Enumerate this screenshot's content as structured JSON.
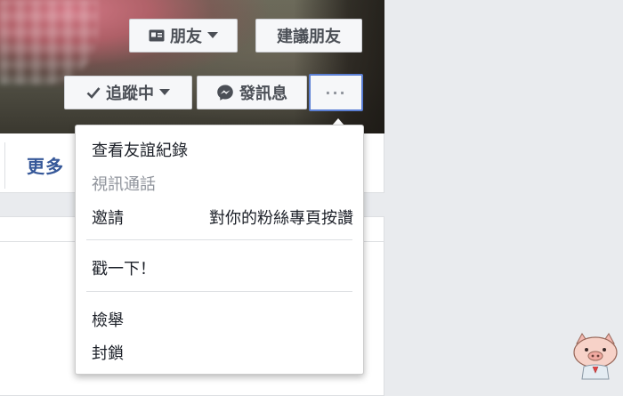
{
  "header_buttons": {
    "friends_label": "朋友",
    "suggest_friends_label": "建議朋友",
    "following_label": "追蹤中",
    "message_label": "發訊息",
    "more_label": "···"
  },
  "nav": {
    "more_tab_label": "更多"
  },
  "menu": {
    "view_friendship": "查看友誼紀錄",
    "video_call": "視訊通話",
    "invite_prefix": "邀請",
    "invite_suffix": "對你的粉絲專頁按讚",
    "poke": "戳一下！",
    "report": "檢舉",
    "block": "封鎖"
  },
  "icons": {
    "friends": "profile-card-icon",
    "following": "checkmark-icon",
    "message": "messenger-icon",
    "dropdown": "caret-down-icon"
  },
  "colors": {
    "link_blue": "#365899",
    "focus_border": "#5b7fd4",
    "button_bg": "#f6f7f9"
  }
}
